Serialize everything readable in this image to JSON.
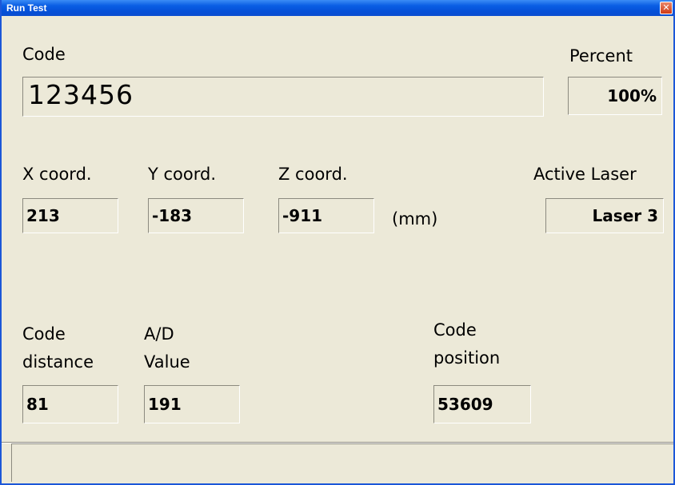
{
  "window": {
    "title": "Run Test",
    "close_glyph": "✕"
  },
  "code": {
    "label": "Code",
    "value": "123456"
  },
  "percent": {
    "label": "Percent",
    "value": "100%"
  },
  "x": {
    "label": "X coord.",
    "value": "213"
  },
  "y": {
    "label": "Y coord.",
    "value": "-183"
  },
  "z": {
    "label": "Z coord.",
    "value": "-911"
  },
  "units": "(mm)",
  "laser": {
    "label": "Active Laser",
    "value": "Laser 3"
  },
  "code_distance": {
    "label_line1": "Code",
    "label_line2": "distance",
    "value": "81"
  },
  "ad_value": {
    "label_line1": "A/D",
    "label_line2": "Value",
    "value": "191"
  },
  "code_position": {
    "label_line1": "Code",
    "label_line2": "position",
    "value": "53609"
  },
  "status": {
    "text": ""
  }
}
